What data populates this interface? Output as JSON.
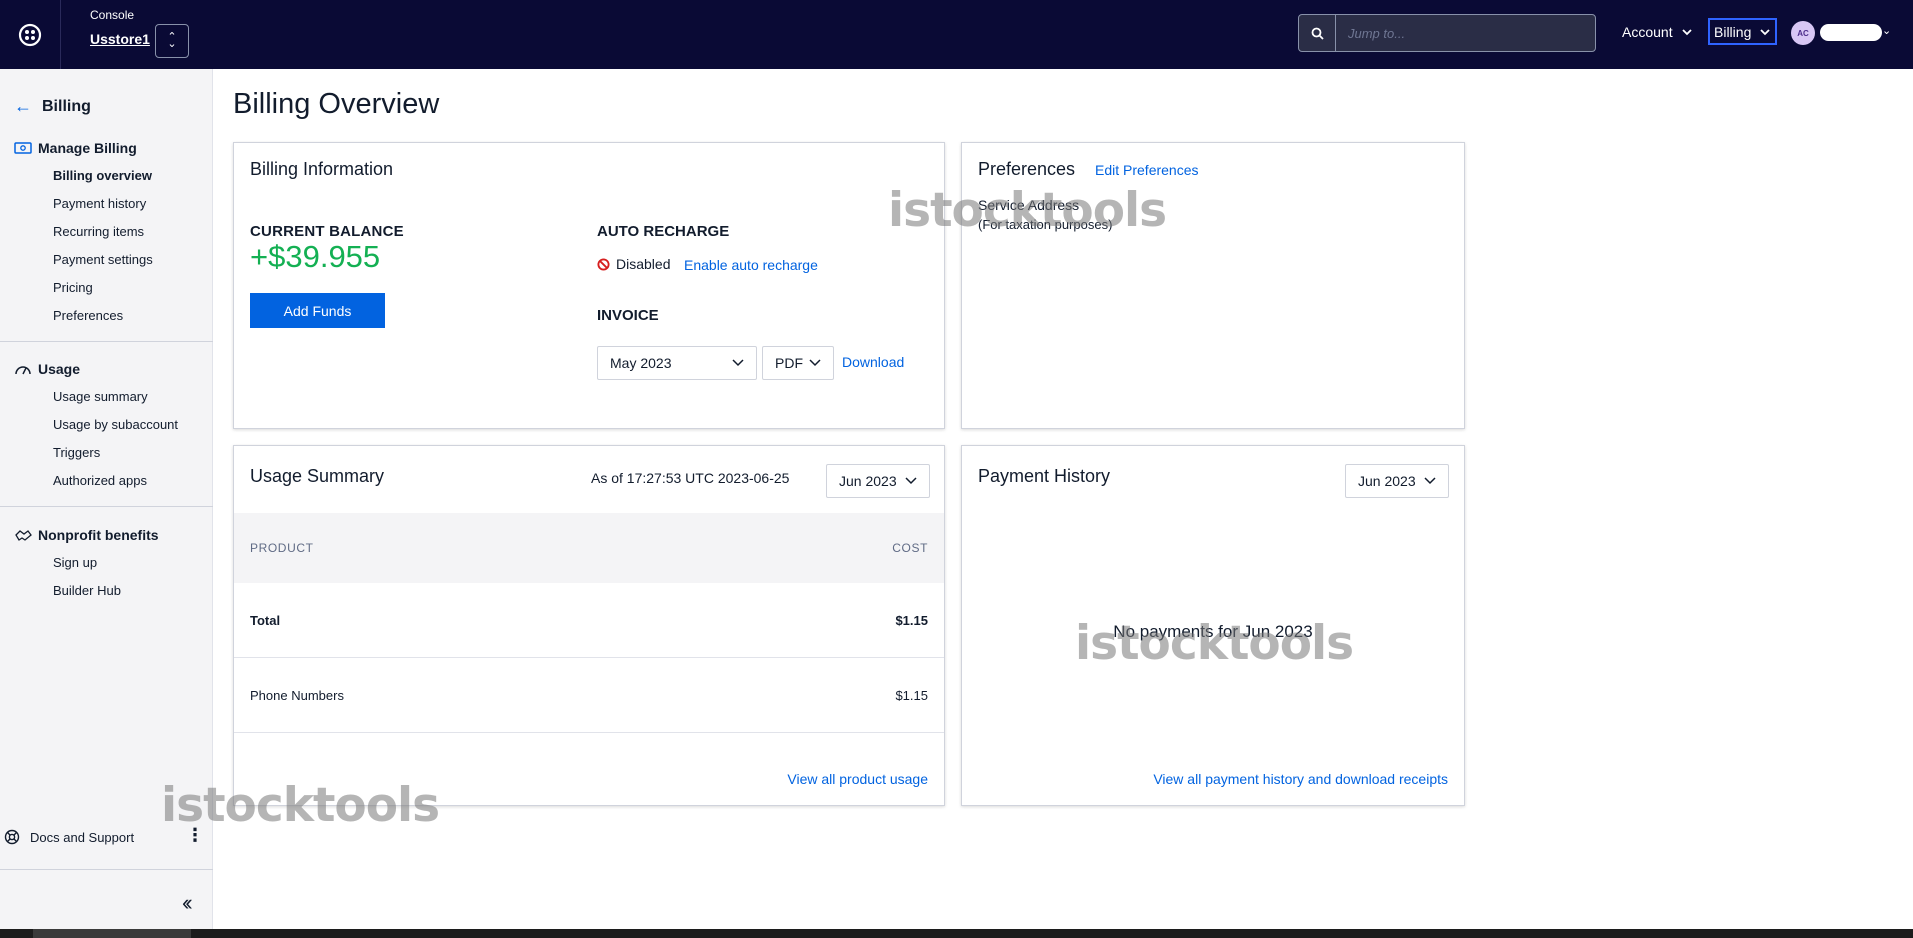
{
  "topbar": {
    "console_label": "Console",
    "account_name": "Usstore1",
    "search_placeholder": "Jump to...",
    "account_menu": "Account",
    "billing_menu": "Billing",
    "avatar_initials": "AC"
  },
  "sidebar": {
    "back_label": "Billing",
    "manage_billing": {
      "heading": "Manage Billing",
      "items": [
        "Billing overview",
        "Payment history",
        "Recurring items",
        "Payment settings",
        "Pricing",
        "Preferences"
      ]
    },
    "usage": {
      "heading": "Usage",
      "items": [
        "Usage summary",
        "Usage by subaccount",
        "Triggers",
        "Authorized apps"
      ]
    },
    "nonprofit": {
      "heading": "Nonprofit benefits",
      "items": [
        "Sign up",
        "Builder Hub"
      ]
    },
    "docs_label": "Docs and Support"
  },
  "main": {
    "page_title": "Billing Overview",
    "billing_info": {
      "title": "Billing Information",
      "balance_label": "CURRENT BALANCE",
      "balance_value": "+$39.955",
      "add_funds": "Add Funds",
      "auto_recharge_label": "AUTO RECHARGE",
      "auto_recharge_status": "Disabled",
      "enable_link": "Enable auto recharge",
      "invoice_label": "INVOICE",
      "invoice_month": "May 2023",
      "invoice_format": "PDF",
      "download_link": "Download"
    },
    "preferences": {
      "title": "Preferences",
      "edit_link": "Edit Preferences",
      "service_address": "Service Address",
      "taxation_note": "(For taxation purposes)"
    },
    "usage_summary": {
      "title": "Usage Summary",
      "as_of": "As of 17:27:53 UTC 2023-06-25",
      "month": "Jun 2023",
      "columns": [
        "PRODUCT",
        "COST"
      ],
      "rows": [
        {
          "product": "Total",
          "cost": "$1.15"
        },
        {
          "product": "Phone Numbers",
          "cost": "$1.15"
        }
      ],
      "view_all": "View all product usage"
    },
    "payment_history": {
      "title": "Payment History",
      "month": "Jun 2023",
      "empty_message": "No payments for Jun 2023",
      "view_all": "View all payment history and download receipts"
    }
  },
  "watermark": "istocktools",
  "colors": {
    "topbar_bg": "#0a0a35",
    "link": "#0263e0",
    "balance_green": "#14b053",
    "primary_button": "#0263e0",
    "focus_outline": "#2f64ff"
  }
}
